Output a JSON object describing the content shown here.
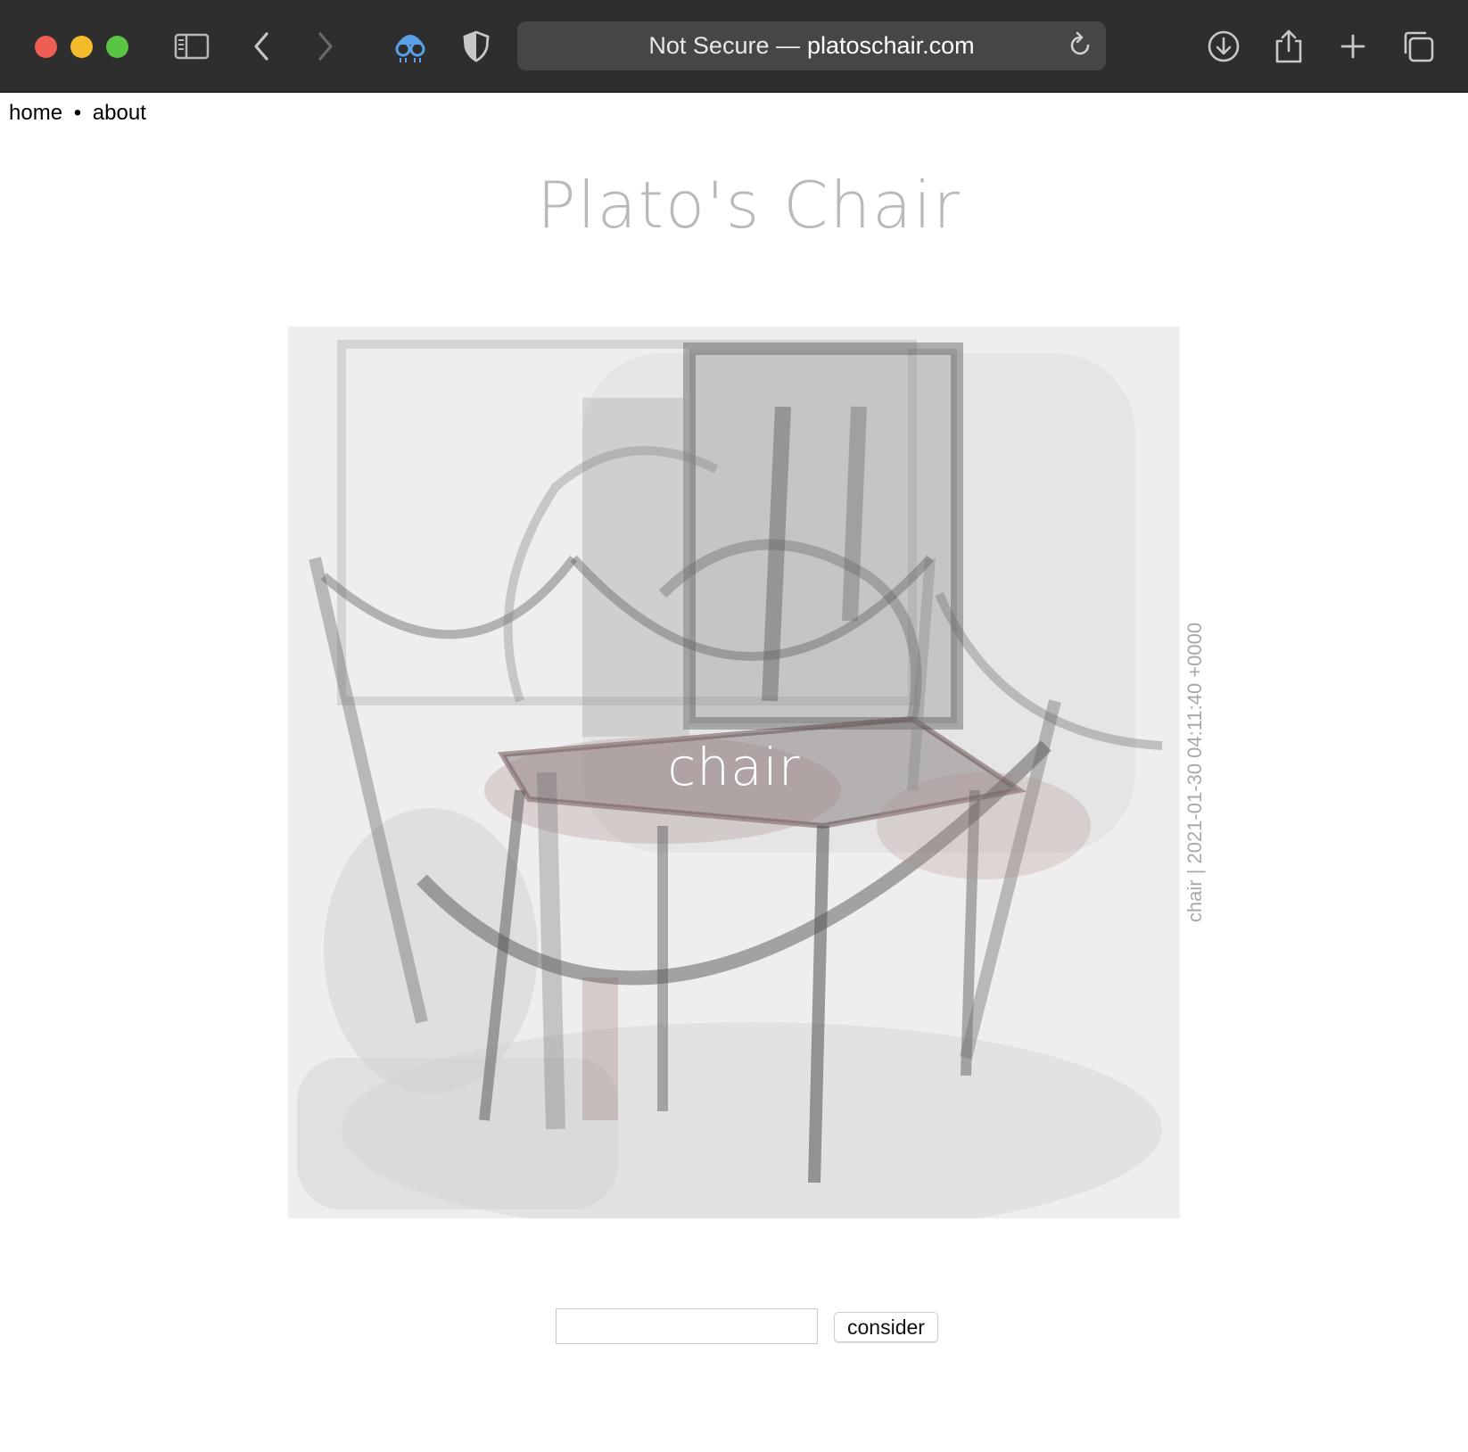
{
  "browser": {
    "address": {
      "security": "Not Secure —",
      "domain": "platoschair.com"
    },
    "icons": [
      "sidebar-icon",
      "back-icon",
      "forward-icon",
      "privacy-report-icon",
      "shield-icon",
      "reload-icon",
      "download-icon",
      "share-icon",
      "new-tab-icon",
      "tab-overview-icon"
    ]
  },
  "nav": {
    "home": "home",
    "separator": "•",
    "about": "about"
  },
  "title": "Plato's Chair",
  "image": {
    "caption": "chair",
    "meta": "chair | 2021-01-30 04:11:40 +0000"
  },
  "form": {
    "input_value": "",
    "button_label": "consider"
  }
}
